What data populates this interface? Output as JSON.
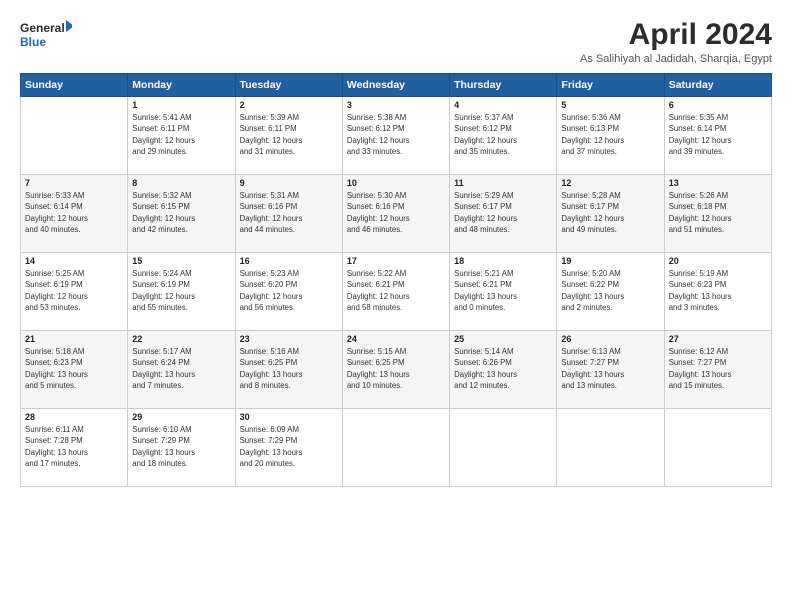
{
  "logo": {
    "line1": "General",
    "line2": "Blue"
  },
  "title": "April 2024",
  "subtitle": "As Salihiyah al Jadidah, Sharqia, Egypt",
  "days_header": [
    "Sunday",
    "Monday",
    "Tuesday",
    "Wednesday",
    "Thursday",
    "Friday",
    "Saturday"
  ],
  "weeks": [
    [
      {
        "day": "",
        "text": ""
      },
      {
        "day": "1",
        "text": "Sunrise: 5:41 AM\nSunset: 6:11 PM\nDaylight: 12 hours\nand 29 minutes."
      },
      {
        "day": "2",
        "text": "Sunrise: 5:39 AM\nSunset: 6:11 PM\nDaylight: 12 hours\nand 31 minutes."
      },
      {
        "day": "3",
        "text": "Sunrise: 5:38 AM\nSunset: 6:12 PM\nDaylight: 12 hours\nand 33 minutes."
      },
      {
        "day": "4",
        "text": "Sunrise: 5:37 AM\nSunset: 6:12 PM\nDaylight: 12 hours\nand 35 minutes."
      },
      {
        "day": "5",
        "text": "Sunrise: 5:36 AM\nSunset: 6:13 PM\nDaylight: 12 hours\nand 37 minutes."
      },
      {
        "day": "6",
        "text": "Sunrise: 5:35 AM\nSunset: 6:14 PM\nDaylight: 12 hours\nand 39 minutes."
      }
    ],
    [
      {
        "day": "7",
        "text": "Sunrise: 5:33 AM\nSunset: 6:14 PM\nDaylight: 12 hours\nand 40 minutes."
      },
      {
        "day": "8",
        "text": "Sunrise: 5:32 AM\nSunset: 6:15 PM\nDaylight: 12 hours\nand 42 minutes."
      },
      {
        "day": "9",
        "text": "Sunrise: 5:31 AM\nSunset: 6:16 PM\nDaylight: 12 hours\nand 44 minutes."
      },
      {
        "day": "10",
        "text": "Sunrise: 5:30 AM\nSunset: 6:16 PM\nDaylight: 12 hours\nand 46 minutes."
      },
      {
        "day": "11",
        "text": "Sunrise: 5:29 AM\nSunset: 6:17 PM\nDaylight: 12 hours\nand 48 minutes."
      },
      {
        "day": "12",
        "text": "Sunrise: 5:28 AM\nSunset: 6:17 PM\nDaylight: 12 hours\nand 49 minutes."
      },
      {
        "day": "13",
        "text": "Sunrise: 5:26 AM\nSunset: 6:18 PM\nDaylight: 12 hours\nand 51 minutes."
      }
    ],
    [
      {
        "day": "14",
        "text": "Sunrise: 5:25 AM\nSunset: 6:19 PM\nDaylight: 12 hours\nand 53 minutes."
      },
      {
        "day": "15",
        "text": "Sunrise: 5:24 AM\nSunset: 6:19 PM\nDaylight: 12 hours\nand 55 minutes."
      },
      {
        "day": "16",
        "text": "Sunrise: 5:23 AM\nSunset: 6:20 PM\nDaylight: 12 hours\nand 56 minutes."
      },
      {
        "day": "17",
        "text": "Sunrise: 5:22 AM\nSunset: 6:21 PM\nDaylight: 12 hours\nand 58 minutes."
      },
      {
        "day": "18",
        "text": "Sunrise: 5:21 AM\nSunset: 6:21 PM\nDaylight: 13 hours\nand 0 minutes."
      },
      {
        "day": "19",
        "text": "Sunrise: 5:20 AM\nSunset: 6:22 PM\nDaylight: 13 hours\nand 2 minutes."
      },
      {
        "day": "20",
        "text": "Sunrise: 5:19 AM\nSunset: 6:23 PM\nDaylight: 13 hours\nand 3 minutes."
      }
    ],
    [
      {
        "day": "21",
        "text": "Sunrise: 5:18 AM\nSunset: 6:23 PM\nDaylight: 13 hours\nand 5 minutes."
      },
      {
        "day": "22",
        "text": "Sunrise: 5:17 AM\nSunset: 6:24 PM\nDaylight: 13 hours\nand 7 minutes."
      },
      {
        "day": "23",
        "text": "Sunrise: 5:16 AM\nSunset: 6:25 PM\nDaylight: 13 hours\nand 8 minutes."
      },
      {
        "day": "24",
        "text": "Sunrise: 5:15 AM\nSunset: 6:25 PM\nDaylight: 13 hours\nand 10 minutes."
      },
      {
        "day": "25",
        "text": "Sunrise: 5:14 AM\nSunset: 6:26 PM\nDaylight: 13 hours\nand 12 minutes."
      },
      {
        "day": "26",
        "text": "Sunrise: 6:13 AM\nSunset: 7:27 PM\nDaylight: 13 hours\nand 13 minutes."
      },
      {
        "day": "27",
        "text": "Sunrise: 6:12 AM\nSunset: 7:27 PM\nDaylight: 13 hours\nand 15 minutes."
      }
    ],
    [
      {
        "day": "28",
        "text": "Sunrise: 6:11 AM\nSunset: 7:28 PM\nDaylight: 13 hours\nand 17 minutes."
      },
      {
        "day": "29",
        "text": "Sunrise: 6:10 AM\nSunset: 7:29 PM\nDaylight: 13 hours\nand 18 minutes."
      },
      {
        "day": "30",
        "text": "Sunrise: 6:09 AM\nSunset: 7:29 PM\nDaylight: 13 hours\nand 20 minutes."
      },
      {
        "day": "",
        "text": ""
      },
      {
        "day": "",
        "text": ""
      },
      {
        "day": "",
        "text": ""
      },
      {
        "day": "",
        "text": ""
      }
    ]
  ]
}
